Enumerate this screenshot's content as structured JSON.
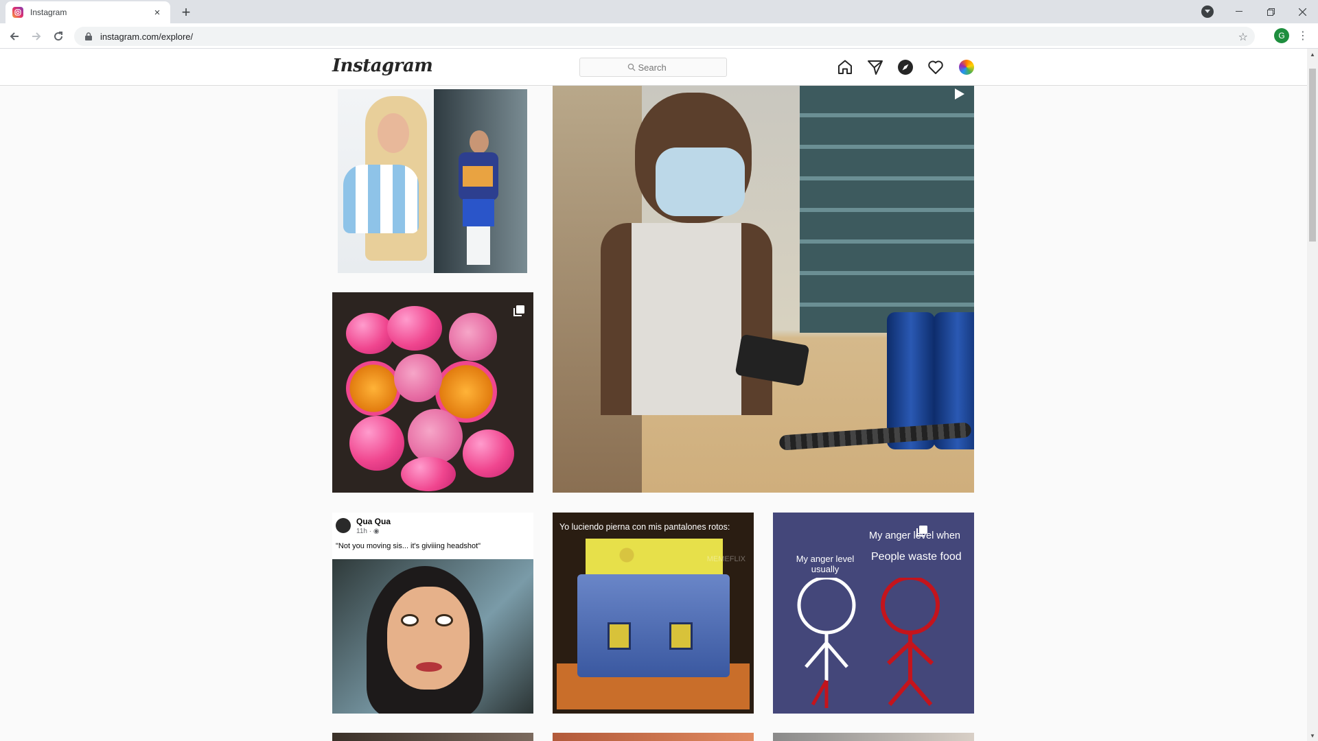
{
  "browser": {
    "tab_title": "Instagram",
    "tab_close": "×",
    "new_tab": "+",
    "url": "instagram.com/explore/",
    "profile_initial": "G",
    "icons": [
      "back-icon",
      "forward-icon",
      "reload-icon",
      "lock-icon",
      "star-icon",
      "kebab-menu-icon",
      "minimize-icon",
      "restore-icon",
      "close-icon"
    ]
  },
  "instagram": {
    "logo": "Instagram",
    "search_placeholder": "Search",
    "nav_icons": [
      "home-icon",
      "direct-icon",
      "explore-icon",
      "activity-icon",
      "profile-avatar"
    ]
  },
  "posts": {
    "qua": {
      "name": "Qua Qua",
      "meta": "11h · ",
      "text": "\"Not you moving sis... it's giviiing headshot\""
    },
    "sponge": {
      "caption": "Yo luciendo pierna con mis pantalones rotos:",
      "watermark": "MEMEFLIX"
    },
    "anger": {
      "top_line": "My anger level when",
      "right_label": "People waste food",
      "left_label": "My anger level usually"
    }
  },
  "colors": {
    "accent_bg": "#fafafa",
    "chrome_tab": "#dee1e6",
    "anger_bg": "#44477a",
    "anger_red": "#c4141c"
  }
}
